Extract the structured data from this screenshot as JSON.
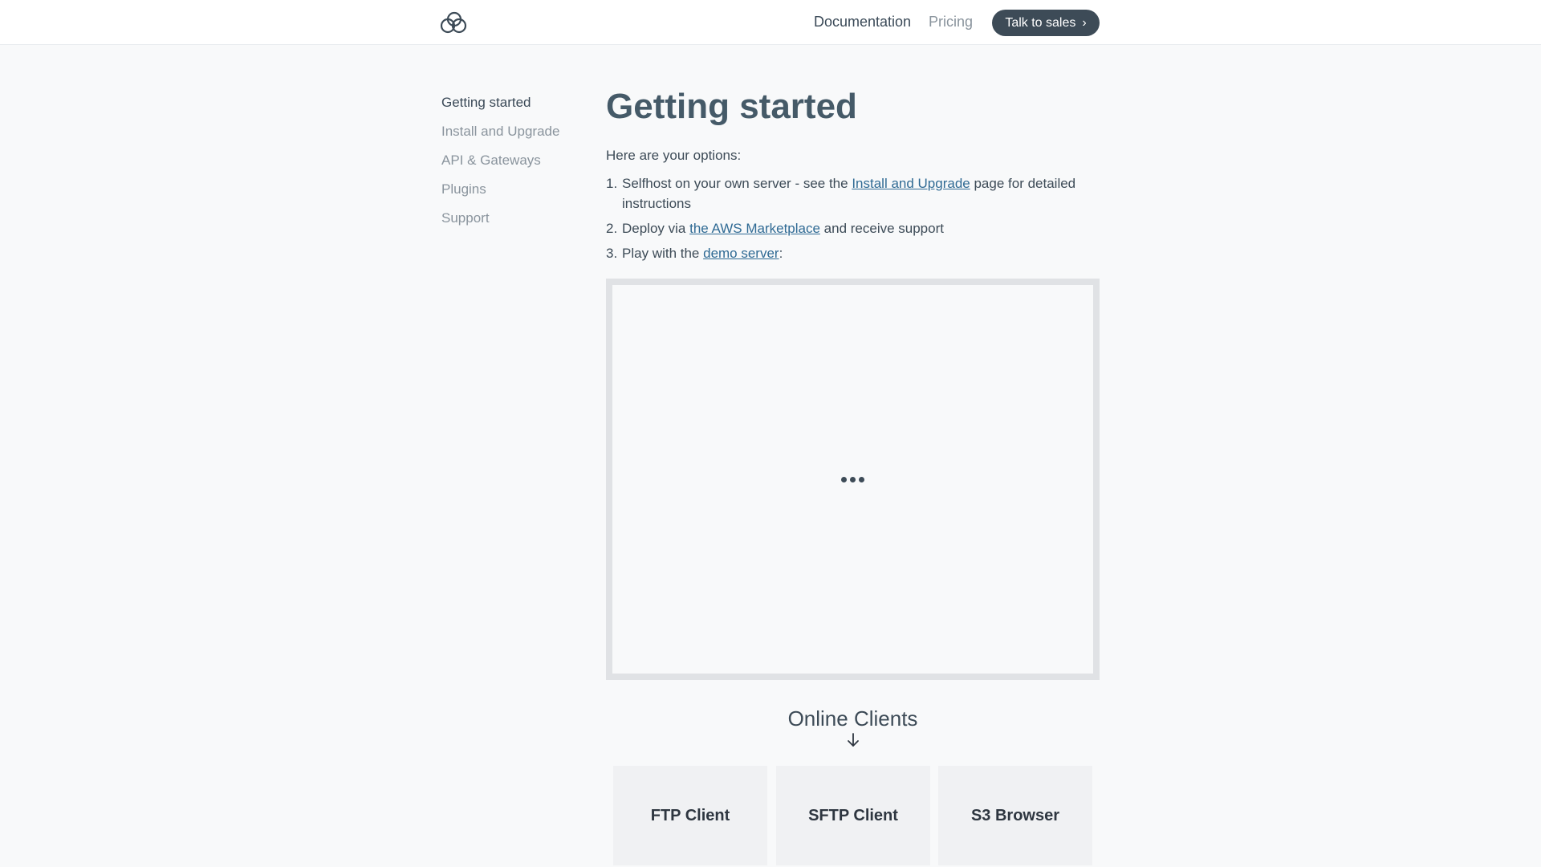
{
  "header": {
    "logo": "cloud-logo",
    "nav": {
      "documentation": "Documentation",
      "pricing": "Pricing"
    },
    "cta_label": "Talk to sales"
  },
  "sidebar": {
    "items": [
      {
        "label": "Getting started",
        "active": true
      },
      {
        "label": "Install and Upgrade",
        "active": false
      },
      {
        "label": "API & Gateways",
        "active": false
      },
      {
        "label": "Plugins",
        "active": false
      },
      {
        "label": "Support",
        "active": false
      }
    ]
  },
  "main": {
    "title": "Getting started",
    "intro": "Here are your options:",
    "options": [
      {
        "num": "1.",
        "before": "Selfhost on your own server - see the ",
        "link": "Install and Upgrade",
        "after": " page for detailed instructions"
      },
      {
        "num": "2.",
        "before": "Deploy via ",
        "link": "the AWS Marketplace",
        "after": " and receive support"
      },
      {
        "num": "3.",
        "before": "Play with the ",
        "link": "demo server",
        "after": ":"
      }
    ],
    "embed_loading_icon": "ellipsis-loading-icon",
    "clients_heading": "Online Clients",
    "clients_arrow_icon": "arrow-down-icon",
    "clients": [
      "FTP Client",
      "SFTP Client",
      "S3 Browser"
    ]
  },
  "colors": {
    "background": "#f8f9fa",
    "cta_bg": "#3d4b57",
    "link": "#2f6a94",
    "title": "#455a68"
  }
}
